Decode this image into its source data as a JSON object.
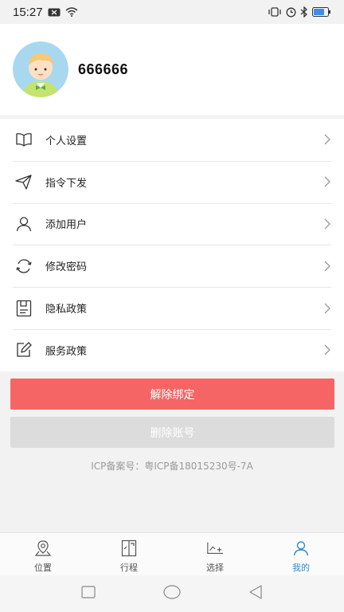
{
  "status_bar": {
    "time": "15:27"
  },
  "profile": {
    "username": "666666"
  },
  "menu": {
    "items": [
      {
        "label": "个人设置",
        "icon": "book-icon"
      },
      {
        "label": "指令下发",
        "icon": "send-icon"
      },
      {
        "label": "添加用户",
        "icon": "user-icon"
      },
      {
        "label": "修改密码",
        "icon": "refresh-icon"
      },
      {
        "label": "隐私政策",
        "icon": "document-icon"
      },
      {
        "label": "服务政策",
        "icon": "edit-icon"
      }
    ]
  },
  "buttons": {
    "unbind": "解除绑定",
    "delete_account": "删除账号"
  },
  "footer": {
    "icp": "ICP备案号：粤ICP备18015230号-7A"
  },
  "tabbar": {
    "tabs": [
      {
        "label": "位置",
        "icon": "location-icon",
        "active": false
      },
      {
        "label": "行程",
        "icon": "trip-icon",
        "active": false
      },
      {
        "label": "选择",
        "icon": "chart-icon",
        "active": false
      },
      {
        "label": "我的",
        "icon": "user-icon",
        "active": true
      }
    ]
  },
  "colors": {
    "primary_red": "#f56565",
    "active_blue": "#2c8bd0",
    "disabled_gray": "#dcdcdc"
  }
}
